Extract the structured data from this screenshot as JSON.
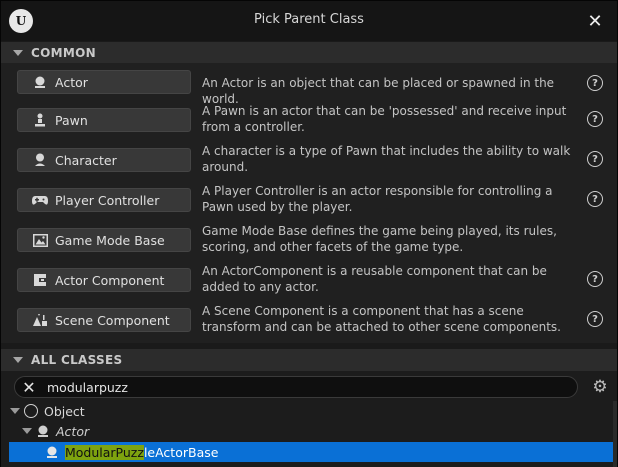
{
  "window": {
    "title": "Pick Parent Class",
    "logo_text": "U"
  },
  "common": {
    "header": "COMMON",
    "items": [
      {
        "label": "Actor",
        "icon": "actor-icon",
        "description": "An Actor is an object that can be placed or spawned in the world."
      },
      {
        "label": "Pawn",
        "icon": "pawn-icon",
        "description": "A Pawn is an actor that can be 'possessed' and receive input from a controller."
      },
      {
        "label": "Character",
        "icon": "character-icon",
        "description": "A character is a type of Pawn that includes the ability to walk around."
      },
      {
        "label": "Player Controller",
        "icon": "gamepad-icon",
        "description": "A Player Controller is an actor responsible for controlling a Pawn used by the player."
      },
      {
        "label": "Game Mode Base",
        "icon": "game-mode-icon",
        "description": "Game Mode Base defines the game being played, its rules, scoring, and other facets of the game type."
      },
      {
        "label": "Actor Component",
        "icon": "actor-component-icon",
        "description": "An ActorComponent is a reusable component that can be added to any actor."
      },
      {
        "label": "Scene Component",
        "icon": "scene-component-icon",
        "description": "A Scene Component is a component that has a scene transform and can be attached to other scene components."
      }
    ],
    "help_glyph": "?"
  },
  "all_classes": {
    "header": "ALL CLASSES",
    "search": {
      "value": "modularpuzz"
    },
    "tree": {
      "root": "Object",
      "child": "Actor",
      "leaf_match": "ModularPuzz",
      "leaf_rest": "leActorBase"
    }
  },
  "colors": {
    "selection": "#0a70d6",
    "match_highlight": "#7ea30f",
    "section_header": "#2c2c2c"
  }
}
